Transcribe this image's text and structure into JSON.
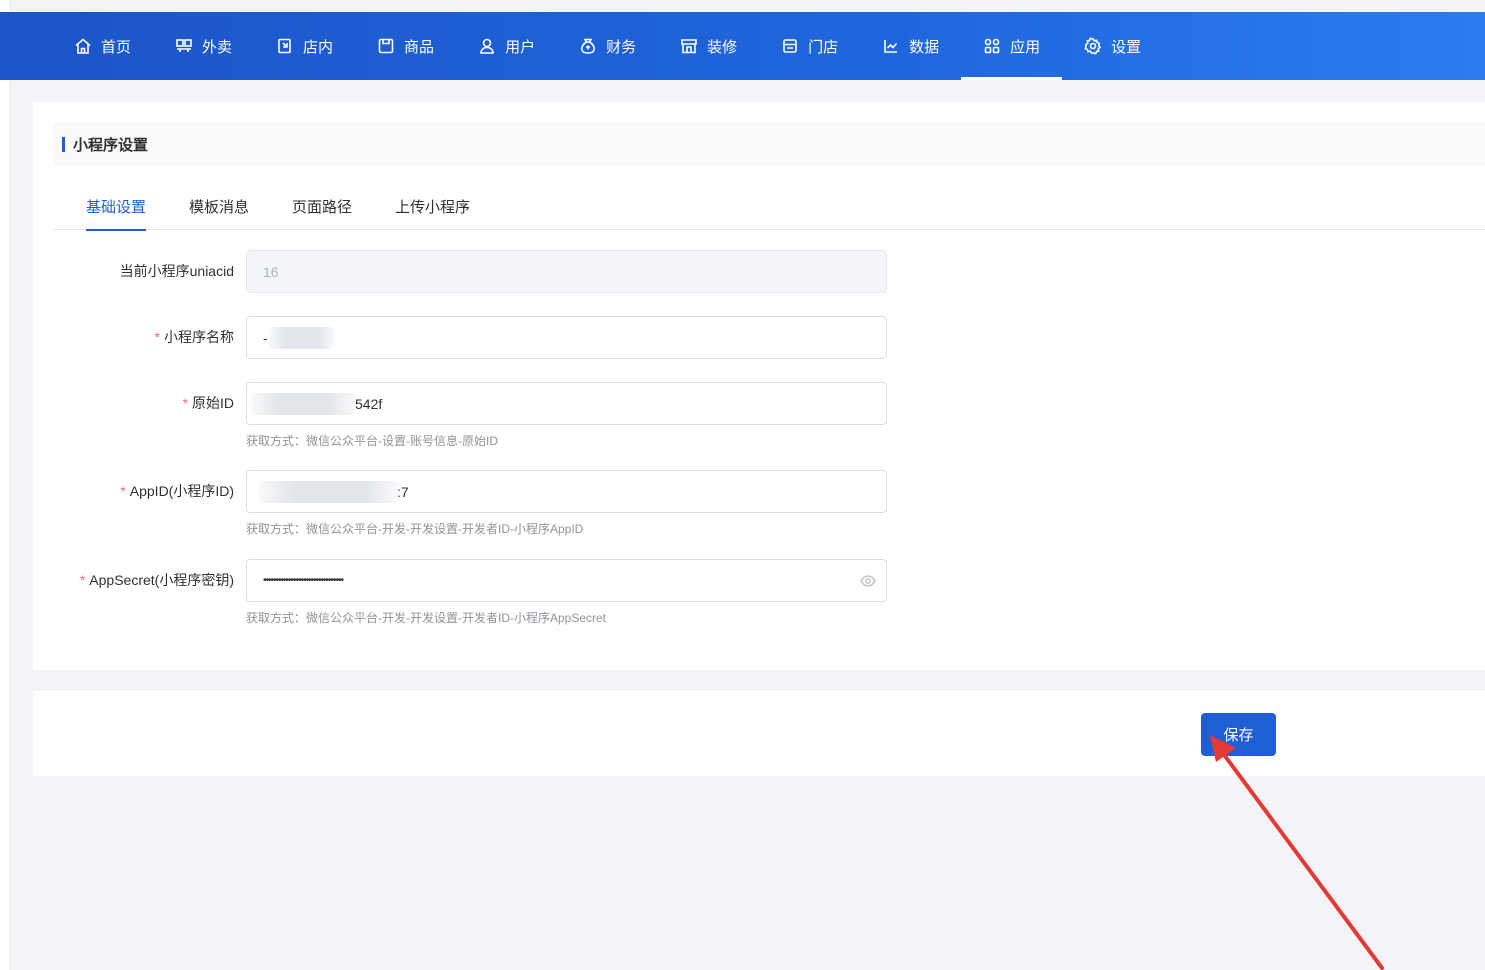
{
  "nav": {
    "items": [
      {
        "label": "首页",
        "icon": "home-icon"
      },
      {
        "label": "外卖",
        "icon": "delivery-icon"
      },
      {
        "label": "店内",
        "icon": "dine-in-icon"
      },
      {
        "label": "商品",
        "icon": "goods-icon"
      },
      {
        "label": "用户",
        "icon": "user-icon"
      },
      {
        "label": "财务",
        "icon": "money-bag-icon"
      },
      {
        "label": "装修",
        "icon": "storefront-icon"
      },
      {
        "label": "门店",
        "icon": "shop-icon"
      },
      {
        "label": "数据",
        "icon": "chart-line-icon"
      },
      {
        "label": "应用",
        "icon": "apps-grid-icon"
      },
      {
        "label": "设置",
        "icon": "gear-icon"
      }
    ],
    "active_label": "应用"
  },
  "section": {
    "title": "小程序设置"
  },
  "tabs": [
    {
      "label": "基础设置",
      "active": true
    },
    {
      "label": "模板消息",
      "active": false
    },
    {
      "label": "页面路径",
      "active": false
    },
    {
      "label": "上传小程序",
      "active": false
    }
  ],
  "form": {
    "uniacid": {
      "label": "当前小程序uniacid",
      "value": "16",
      "required": false
    },
    "name": {
      "label": "小程序名称",
      "value": "-",
      "required": true
    },
    "origin_id": {
      "label": "原始ID",
      "value": "542f",
      "required": true,
      "help": "获取方式：微信公众平台-设置-账号信息-原始ID"
    },
    "appid": {
      "label": "AppID(小程序ID)",
      "value": ":7",
      "required": true,
      "help": "获取方式：微信公众平台-开发-开发设置-开发者ID-小程序AppID"
    },
    "appsecret": {
      "label": "AppSecret(小程序密钥)",
      "value": "••••••••••••••••••••••••••••••••",
      "required": true,
      "help": "获取方式：微信公众平台-开发-开发设置-开发者ID-小程序AppSecret"
    }
  },
  "footer": {
    "save_label": "保存"
  },
  "colors": {
    "primary": "#1f5fd6",
    "annotation_arrow": "#e53935",
    "required_mark": "#f56c6c"
  }
}
